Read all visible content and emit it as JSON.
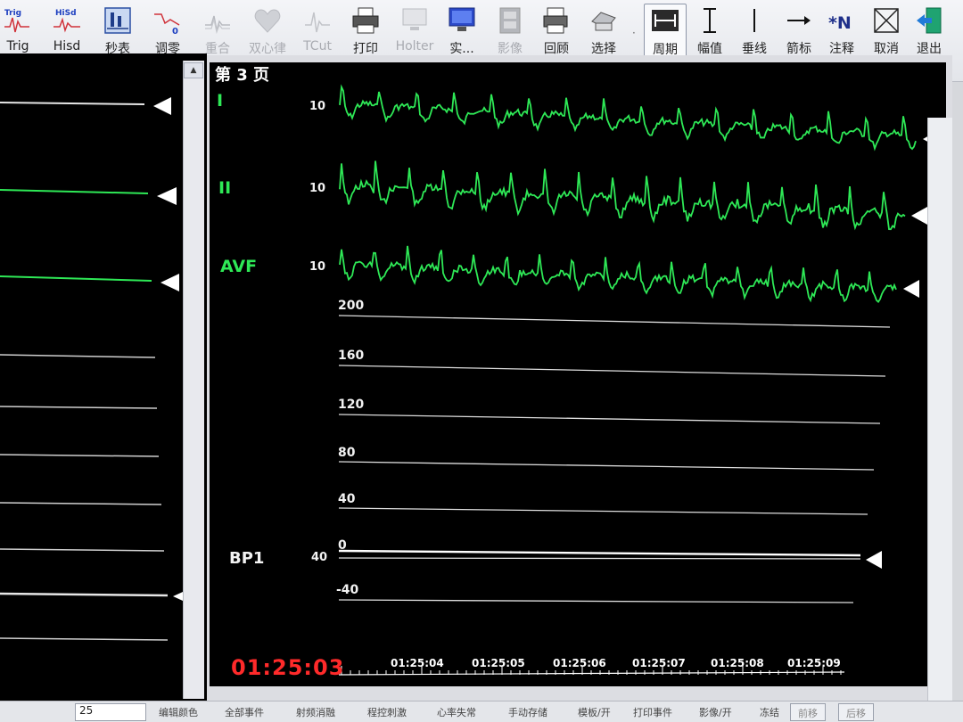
{
  "toolbar": {
    "buttons": [
      {
        "icon": "trig-icon",
        "icon_text": "Trig",
        "label": "Trig",
        "enabled": true
      },
      {
        "icon": "hisd-icon",
        "icon_text": "HiSd",
        "label": "Hisd",
        "enabled": true
      },
      {
        "icon": "stopwatch-icon",
        "label": "秒表",
        "enabled": true
      },
      {
        "icon": "adjust-zero-icon",
        "icon_text": "0",
        "label": "调零",
        "enabled": true
      },
      {
        "icon": "overlay-icon",
        "label": "重合",
        "enabled": false
      },
      {
        "icon": "heart-icon",
        "label": "双心律",
        "enabled": false
      },
      {
        "icon": "tcut-icon",
        "label": "TCut",
        "enabled": false
      },
      {
        "icon": "printer-icon",
        "label": "打印",
        "enabled": true
      },
      {
        "icon": "holter-icon",
        "label": "Holter",
        "enabled": false
      },
      {
        "icon": "realtime-icon",
        "label": "实...",
        "enabled": true
      },
      {
        "icon": "film-icon",
        "label": "影像",
        "enabled": false
      },
      {
        "icon": "review-icon",
        "label": "回顾",
        "enabled": true
      },
      {
        "icon": "select-icon",
        "label": "选择",
        "enabled": true
      },
      {
        "icon": "period-icon",
        "label": "周期",
        "enabled": true,
        "active": true
      },
      {
        "icon": "amplitude-icon",
        "label": "幅值",
        "enabled": true
      },
      {
        "icon": "vertical-line-icon",
        "label": "垂线",
        "enabled": true
      },
      {
        "icon": "arrow-icon",
        "label": "箭标",
        "enabled": true
      },
      {
        "icon": "annotation-icon",
        "icon_text": "*N",
        "label": "注释",
        "enabled": true
      },
      {
        "icon": "cancel-icon",
        "label": "取消",
        "enabled": true
      },
      {
        "icon": "exit-icon",
        "label": "退出",
        "enabled": true
      }
    ]
  },
  "monitor": {
    "page_title": "第 3 页",
    "channels": [
      {
        "name": "I",
        "gain": "10"
      },
      {
        "name": "II",
        "gain": "10"
      },
      {
        "name": "AVF",
        "gain": "10"
      }
    ],
    "bp": {
      "name": "BP1",
      "gain": "40",
      "scale": [
        "200",
        "160",
        "120",
        "80",
        "40",
        "0",
        "-40"
      ]
    },
    "time_main": "01:25:03",
    "time_ticks": [
      "01:25:04",
      "01:25:05",
      "01:25:06",
      "01:25:07",
      "01:25:08",
      "01:25:09"
    ],
    "colors": {
      "ecg": "#2ee856",
      "time": "#ff2a2a",
      "background": "#000000",
      "grid": "#ffffff"
    }
  },
  "statusbar": {
    "input_value": "25",
    "items": [
      "编辑颜色",
      "全部事件",
      "射频消融",
      "程控刺激",
      "心率失常",
      "手动存储",
      "模板/开",
      "打印事件",
      "影像/开",
      "冻结"
    ],
    "btn_prev": "前移",
    "btn_next": "后移"
  }
}
